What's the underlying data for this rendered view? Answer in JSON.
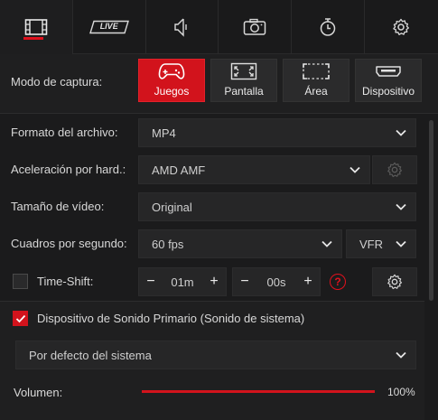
{
  "tabs": [
    {
      "name": "video",
      "icon": "film-icon",
      "active": true
    },
    {
      "name": "live",
      "icon": "live-icon",
      "label": "LIVE",
      "active": false
    },
    {
      "name": "audio",
      "icon": "speaker-icon",
      "active": false
    },
    {
      "name": "screenshot",
      "icon": "camera-icon",
      "active": false
    },
    {
      "name": "timer",
      "icon": "stopwatch-icon",
      "active": false
    },
    {
      "name": "settings",
      "icon": "gear-icon",
      "active": false
    }
  ],
  "capture": {
    "label": "Modo de captura:",
    "modes": [
      {
        "label": "Juegos",
        "icon": "gamepad-icon",
        "active": true
      },
      {
        "label": "Pantalla",
        "icon": "fullscreen-icon",
        "active": false
      },
      {
        "label": "Área",
        "icon": "area-icon",
        "active": false
      },
      {
        "label": "Dispositivo",
        "icon": "hdmi-icon",
        "active": false
      }
    ]
  },
  "settings": {
    "format": {
      "label": "Formato del archivo:",
      "value": "MP4"
    },
    "accel": {
      "label": "Aceleración por hard.:",
      "value": "AMD AMF"
    },
    "size": {
      "label": "Tamaño de vídeo:",
      "value": "Original"
    },
    "fps": {
      "label": "Cuadros por segundo:",
      "value": "60 fps",
      "mode": "VFR"
    },
    "timeshift": {
      "label": "Time-Shift:",
      "checked": false,
      "minutes": "01m",
      "seconds": "00s",
      "warn": "?"
    }
  },
  "audio": {
    "primary_label": "Dispositivo de Sonido Primario (Sonido de sistema)",
    "primary_checked": true,
    "device": "Por defecto del sistema",
    "volume_label": "Volumen:",
    "volume_text": "100%",
    "volume_fraction": 1.0
  },
  "colors": {
    "accent": "#d2131c",
    "background": "#1b1b1c",
    "panel": "#262627"
  }
}
